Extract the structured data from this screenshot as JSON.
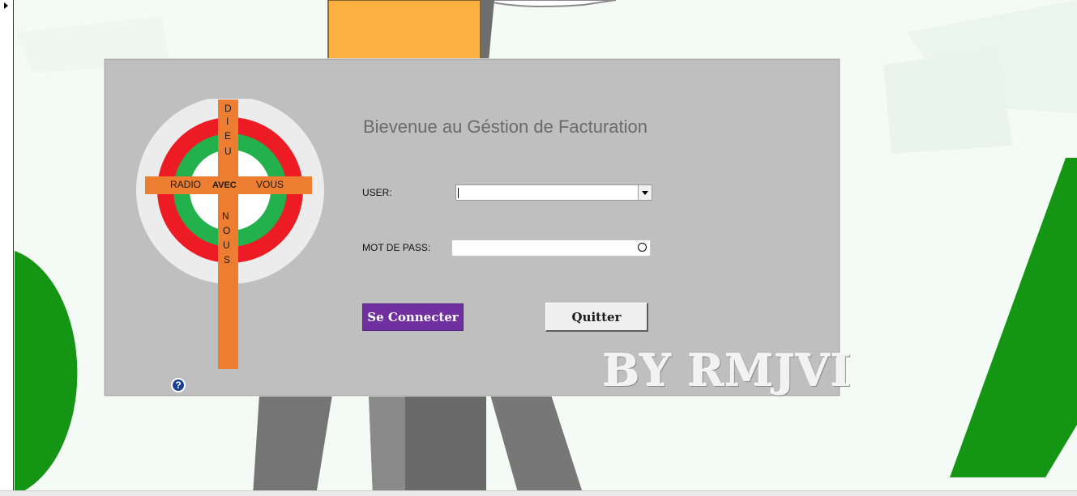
{
  "dialog": {
    "title": "Bievenue au Géstion de Facturation",
    "user_label": "USER:",
    "user_value": "",
    "password_label": "MOT DE PASS:",
    "password_value": "",
    "connect_label": "Se Connecter",
    "quit_label": "Quitter",
    "watermark": "BY RMJVI",
    "help_glyph": "?"
  },
  "logo": {
    "left_word": "RADIO",
    "center_word": "AVEC",
    "right_word": "VOUS",
    "top_letters": [
      "D",
      "I",
      "E",
      "U"
    ],
    "bottom_letters": [
      "N",
      "O",
      "U",
      "S"
    ]
  },
  "colors": {
    "dialog_bg": "#bfbfbf",
    "connect_button": "#7030a0",
    "cross": "#ed7d31",
    "ring_red": "#ed1c24",
    "ring_green": "#22b14c",
    "background_green": "#149614",
    "background_orange": "#fbb040"
  },
  "icons": [
    "dropdown-arrow-icon",
    "radio-circle-icon",
    "help-icon",
    "menu-arrow-icon"
  ]
}
